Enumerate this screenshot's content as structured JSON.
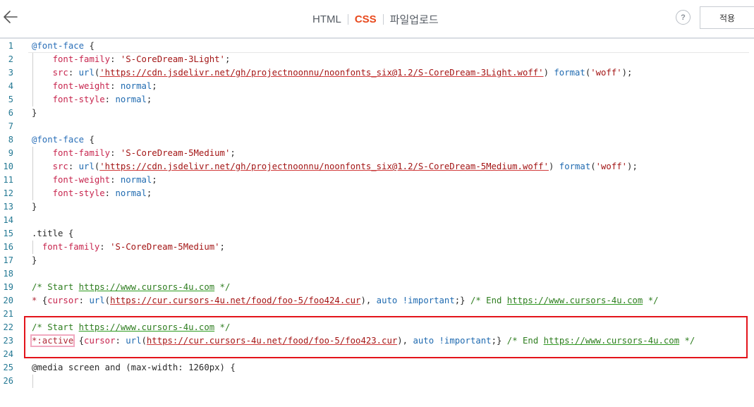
{
  "header": {
    "back_icon": "arrow-left-icon",
    "tabs": [
      {
        "label": "HTML",
        "active": false
      },
      {
        "label": "CSS",
        "active": true
      },
      {
        "label": "파일업로드",
        "active": false
      }
    ],
    "help_label": "?",
    "apply_label": "적용"
  },
  "colors": {
    "active_tab": "#e8491d",
    "line_number": "#237893",
    "highlight_border": "#e3141b",
    "selector_box": "#f1a9c0"
  },
  "editor": {
    "lines": [
      {
        "n": "1",
        "tokens": [
          {
            "t": "@font-face",
            "c": "t-kw"
          },
          {
            "t": " {",
            "c": ""
          }
        ]
      },
      {
        "n": "2",
        "tokens": [
          {
            "t": "    ",
            "c": ""
          },
          {
            "t": "font-family",
            "c": "t-prop"
          },
          {
            "t": ": ",
            "c": ""
          },
          {
            "t": "'S-CoreDream-3Light'",
            "c": "t-str"
          },
          {
            "t": ";",
            "c": ""
          }
        ]
      },
      {
        "n": "3",
        "tokens": [
          {
            "t": "    ",
            "c": ""
          },
          {
            "t": "src",
            "c": "t-prop"
          },
          {
            "t": ": ",
            "c": ""
          },
          {
            "t": "url",
            "c": "t-fn"
          },
          {
            "t": "(",
            "c": ""
          },
          {
            "t": "'https://cdn.jsdelivr.net/gh/projectnoonnu/noonfonts_six@1.2/S-CoreDream-3Light.woff'",
            "c": "t-url"
          },
          {
            "t": ") ",
            "c": ""
          },
          {
            "t": "format",
            "c": "t-fn"
          },
          {
            "t": "(",
            "c": ""
          },
          {
            "t": "'woff'",
            "c": "t-str"
          },
          {
            "t": ");",
            "c": ""
          }
        ]
      },
      {
        "n": "4",
        "tokens": [
          {
            "t": "    ",
            "c": ""
          },
          {
            "t": "font-weight",
            "c": "t-prop"
          },
          {
            "t": ": ",
            "c": ""
          },
          {
            "t": "normal",
            "c": "t-val"
          },
          {
            "t": ";",
            "c": ""
          }
        ]
      },
      {
        "n": "5",
        "tokens": [
          {
            "t": "    ",
            "c": ""
          },
          {
            "t": "font-style",
            "c": "t-prop"
          },
          {
            "t": ": ",
            "c": ""
          },
          {
            "t": "normal",
            "c": "t-val"
          },
          {
            "t": ";",
            "c": ""
          }
        ]
      },
      {
        "n": "6",
        "tokens": [
          {
            "t": "}",
            "c": ""
          }
        ]
      },
      {
        "n": "7",
        "tokens": []
      },
      {
        "n": "8",
        "tokens": [
          {
            "t": "@font-face",
            "c": "t-kw"
          },
          {
            "t": " {",
            "c": ""
          }
        ]
      },
      {
        "n": "9",
        "tokens": [
          {
            "t": "    ",
            "c": ""
          },
          {
            "t": "font-family",
            "c": "t-prop"
          },
          {
            "t": ": ",
            "c": ""
          },
          {
            "t": "'S-CoreDream-5Medium'",
            "c": "t-str"
          },
          {
            "t": ";",
            "c": ""
          }
        ]
      },
      {
        "n": "10",
        "tokens": [
          {
            "t": "    ",
            "c": ""
          },
          {
            "t": "src",
            "c": "t-prop"
          },
          {
            "t": ": ",
            "c": ""
          },
          {
            "t": "url",
            "c": "t-fn"
          },
          {
            "t": "(",
            "c": ""
          },
          {
            "t": "'https://cdn.jsdelivr.net/gh/projectnoonnu/noonfonts_six@1.2/S-CoreDream-5Medium.woff'",
            "c": "t-url"
          },
          {
            "t": ") ",
            "c": ""
          },
          {
            "t": "format",
            "c": "t-fn"
          },
          {
            "t": "(",
            "c": ""
          },
          {
            "t": "'woff'",
            "c": "t-str"
          },
          {
            "t": ");",
            "c": ""
          }
        ]
      },
      {
        "n": "11",
        "tokens": [
          {
            "t": "    ",
            "c": ""
          },
          {
            "t": "font-weight",
            "c": "t-prop"
          },
          {
            "t": ": ",
            "c": ""
          },
          {
            "t": "normal",
            "c": "t-val"
          },
          {
            "t": ";",
            "c": ""
          }
        ]
      },
      {
        "n": "12",
        "tokens": [
          {
            "t": "    ",
            "c": ""
          },
          {
            "t": "font-style",
            "c": "t-prop"
          },
          {
            "t": ": ",
            "c": ""
          },
          {
            "t": "normal",
            "c": "t-val"
          },
          {
            "t": ";",
            "c": ""
          }
        ]
      },
      {
        "n": "13",
        "tokens": [
          {
            "t": "}",
            "c": ""
          }
        ]
      },
      {
        "n": "14",
        "tokens": []
      },
      {
        "n": "15",
        "tokens": [
          {
            "t": ".title",
            "c": "t-sel"
          },
          {
            "t": " {",
            "c": ""
          }
        ]
      },
      {
        "n": "16",
        "tokens": [
          {
            "t": "  ",
            "c": ""
          },
          {
            "t": "font-family",
            "c": "t-prop"
          },
          {
            "t": ": ",
            "c": ""
          },
          {
            "t": "'S-CoreDream-5Medium'",
            "c": "t-str"
          },
          {
            "t": ";",
            "c": ""
          }
        ]
      },
      {
        "n": "17",
        "tokens": [
          {
            "t": "}",
            "c": ""
          }
        ]
      },
      {
        "n": "18",
        "tokens": []
      },
      {
        "n": "19",
        "tokens": [
          {
            "t": "/* Start ",
            "c": "t-com"
          },
          {
            "t": "https://www.cursors-4u.com",
            "c": "t-comurl"
          },
          {
            "t": " */",
            "c": "t-com"
          }
        ]
      },
      {
        "n": "20",
        "tokens": [
          {
            "t": "*",
            "c": "t-prop2"
          },
          {
            "t": " {",
            "c": ""
          },
          {
            "t": "cursor",
            "c": "t-prop"
          },
          {
            "t": ": ",
            "c": ""
          },
          {
            "t": "url",
            "c": "t-fn"
          },
          {
            "t": "(",
            "c": ""
          },
          {
            "t": "https://cur.cursors-4u.net/food/foo-5/foo424.cur",
            "c": "t-url"
          },
          {
            "t": "), ",
            "c": ""
          },
          {
            "t": "auto",
            "c": "t-val"
          },
          {
            "t": " ",
            "c": ""
          },
          {
            "t": "!important",
            "c": "t-imp"
          },
          {
            "t": ";} ",
            "c": ""
          },
          {
            "t": "/* End ",
            "c": "t-com"
          },
          {
            "t": "https://www.cursors-4u.com",
            "c": "t-comurl"
          },
          {
            "t": " */",
            "c": "t-com"
          }
        ]
      },
      {
        "n": "21",
        "tokens": []
      },
      {
        "n": "22",
        "tokens": [
          {
            "t": "/* Start ",
            "c": "t-com"
          },
          {
            "t": "https://www.cursors-4u.com",
            "c": "t-comurl"
          },
          {
            "t": " */",
            "c": "t-com"
          }
        ]
      },
      {
        "n": "23",
        "tokens": [
          {
            "t": "*:active",
            "c": "t-prop2 sel-box"
          },
          {
            "t": " {",
            "c": ""
          },
          {
            "t": "cursor",
            "c": "t-prop"
          },
          {
            "t": ": ",
            "c": ""
          },
          {
            "t": "url",
            "c": "t-fn"
          },
          {
            "t": "(",
            "c": ""
          },
          {
            "t": "https://cur.cursors-4u.net/food/foo-5/foo423.cur",
            "c": "t-url"
          },
          {
            "t": "), ",
            "c": ""
          },
          {
            "t": "auto",
            "c": "t-val"
          },
          {
            "t": " ",
            "c": ""
          },
          {
            "t": "!important",
            "c": "t-imp"
          },
          {
            "t": ";} ",
            "c": ""
          },
          {
            "t": "/* End ",
            "c": "t-com"
          },
          {
            "t": "https://www.cursors-4u.com",
            "c": "t-comurl"
          },
          {
            "t": " */",
            "c": "t-com"
          }
        ]
      },
      {
        "n": "24",
        "tokens": []
      },
      {
        "n": "25",
        "tokens": [
          {
            "t": "@media screen and (max-width: ",
            "c": "t-num"
          },
          {
            "t": "1260",
            "c": "t-num"
          },
          {
            "t": "px) {",
            "c": "t-num"
          }
        ]
      },
      {
        "n": "26",
        "tokens": []
      }
    ]
  }
}
